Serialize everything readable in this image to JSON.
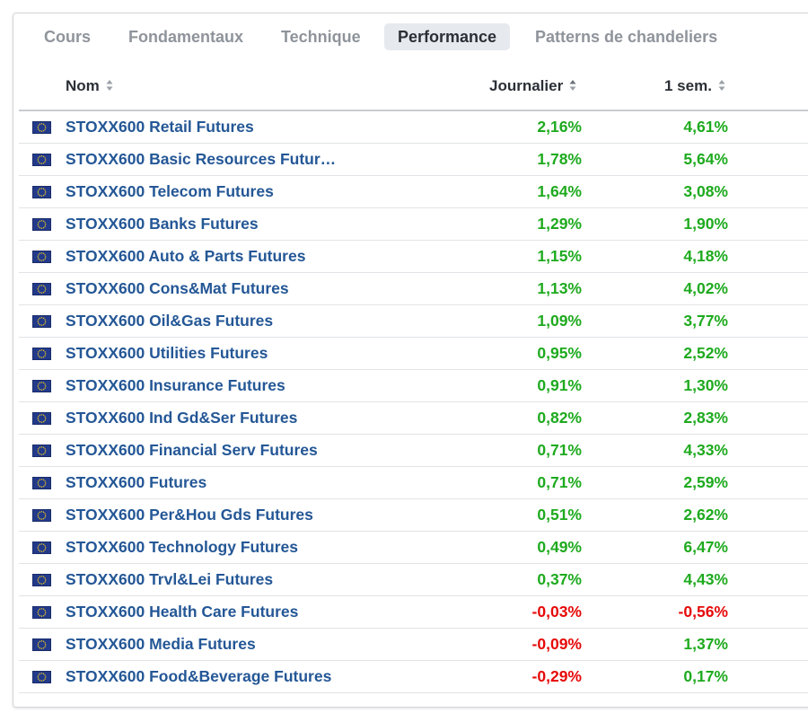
{
  "tabs": [
    {
      "label": "Cours",
      "active": false
    },
    {
      "label": "Fondamentaux",
      "active": false
    },
    {
      "label": "Technique",
      "active": false
    },
    {
      "label": "Performance",
      "active": true
    },
    {
      "label": "Patterns de chandeliers",
      "active": false
    }
  ],
  "columns": {
    "name": "Nom",
    "daily": "Journalier",
    "week": "1 sem."
  },
  "colors": {
    "positive": "#1eaa1e",
    "negative": "#e60a0a",
    "link": "#245796"
  },
  "row_icon": "eu-flag-icon",
  "rows": [
    {
      "name": "STOXX600 Retail Futures",
      "daily": "2,16%",
      "week": "4,61%"
    },
    {
      "name": "STOXX600 Basic Resources Futur…",
      "daily": "1,78%",
      "week": "5,64%"
    },
    {
      "name": "STOXX600 Telecom Futures",
      "daily": "1,64%",
      "week": "3,08%"
    },
    {
      "name": "STOXX600 Banks Futures",
      "daily": "1,29%",
      "week": "1,90%"
    },
    {
      "name": "STOXX600 Auto & Parts Futures",
      "daily": "1,15%",
      "week": "4,18%"
    },
    {
      "name": "STOXX600 Cons&Mat Futures",
      "daily": "1,13%",
      "week": "4,02%"
    },
    {
      "name": "STOXX600 Oil&Gas Futures",
      "daily": "1,09%",
      "week": "3,77%"
    },
    {
      "name": "STOXX600 Utilities Futures",
      "daily": "0,95%",
      "week": "2,52%"
    },
    {
      "name": "STOXX600 Insurance Futures",
      "daily": "0,91%",
      "week": "1,30%"
    },
    {
      "name": "STOXX600 Ind Gd&Ser Futures",
      "daily": "0,82%",
      "week": "2,83%"
    },
    {
      "name": "STOXX600 Financial Serv Futures",
      "daily": "0,71%",
      "week": "4,33%"
    },
    {
      "name": "STOXX600 Futures",
      "daily": "0,71%",
      "week": "2,59%"
    },
    {
      "name": "STOXX600 Per&Hou Gds Futures",
      "daily": "0,51%",
      "week": "2,62%"
    },
    {
      "name": "STOXX600 Technology Futures",
      "daily": "0,49%",
      "week": "6,47%"
    },
    {
      "name": "STOXX600 Trvl&Lei Futures",
      "daily": "0,37%",
      "week": "4,43%"
    },
    {
      "name": "STOXX600 Health Care Futures",
      "daily": "-0,03%",
      "week": "-0,56%"
    },
    {
      "name": "STOXX600 Media Futures",
      "daily": "-0,09%",
      "week": "1,37%"
    },
    {
      "name": "STOXX600 Food&Beverage Futures",
      "daily": "-0,29%",
      "week": "0,17%"
    }
  ]
}
